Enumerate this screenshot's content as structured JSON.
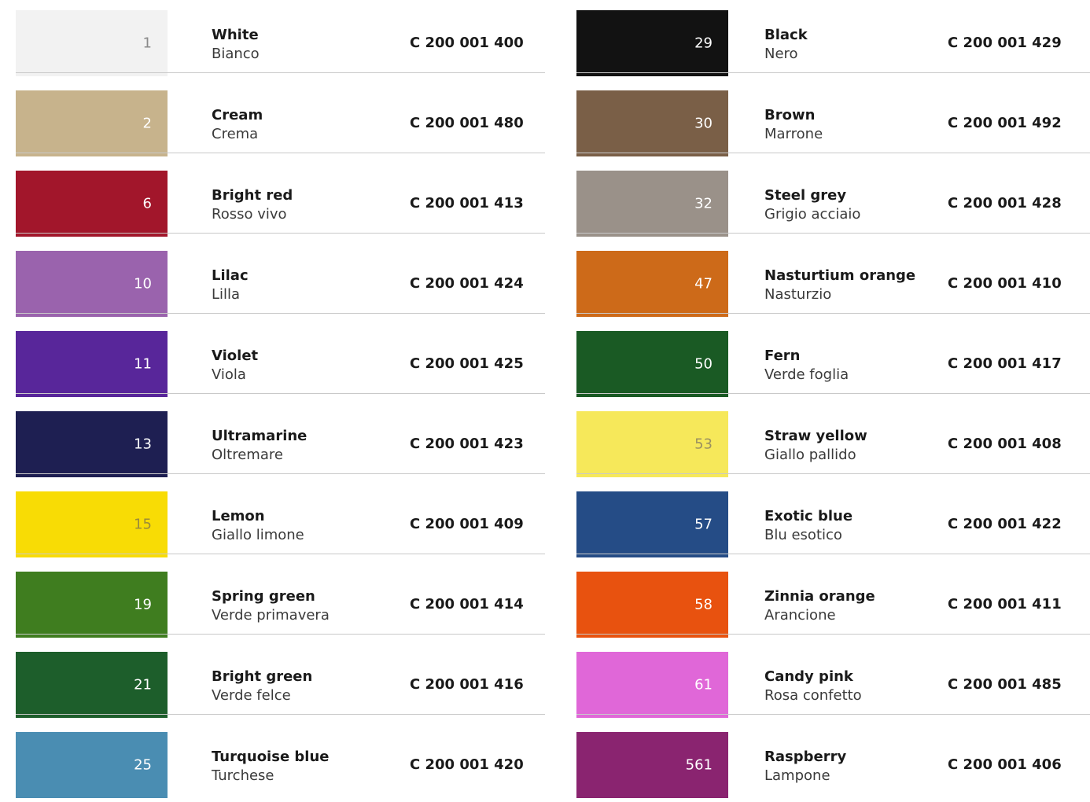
{
  "left_column": [
    {
      "number": "1",
      "name_en": "White",
      "name_it": "Bianco",
      "code": "C 200 001 400",
      "color": "#f2f2f2"
    },
    {
      "number": "2",
      "name_en": "Cream",
      "name_it": "Crema",
      "code": "C 200 001 480",
      "color": "#c7b38c"
    },
    {
      "number": "6",
      "name_en": "Bright red",
      "name_it": "Rosso vivo",
      "code": "C 200 001 413",
      "color": "#a2162b"
    },
    {
      "number": "10",
      "name_en": "Lilac",
      "name_it": "Lilla",
      "code": "C 200 001 424",
      "color": "#9a63ad"
    },
    {
      "number": "11",
      "name_en": "Violet",
      "name_it": "Viola",
      "code": "C 200 001 425",
      "color": "#58269a"
    },
    {
      "number": "13",
      "name_en": "Ultramarine",
      "name_it": "Oltremare",
      "code": "C 200 001 423",
      "color": "#1e1f52"
    },
    {
      "number": "15",
      "name_en": "Lemon",
      "name_it": "Giallo limone",
      "code": "C 200 001 409",
      "color": "#f8dc05"
    },
    {
      "number": "19",
      "name_en": "Spring green",
      "name_it": "Verde primavera",
      "code": "C 200 001 414",
      "color": "#3f7d1f"
    },
    {
      "number": "21",
      "name_en": "Bright green",
      "name_it": "Verde felce",
      "code": "C 200 001 416",
      "color": "#1d5e2b"
    },
    {
      "number": "25",
      "name_en": "Turquoise blue",
      "name_it": "Turchese",
      "code": "C 200 001 420",
      "color": "#4a8db2"
    }
  ],
  "right_column": [
    {
      "number": "29",
      "name_en": "Black",
      "name_it": "Nero",
      "code": "C 200 001 429",
      "color": "#121212"
    },
    {
      "number": "30",
      "name_en": "Brown",
      "name_it": "Marrone",
      "code": "C 200 001 492",
      "color": "#7a5f47"
    },
    {
      "number": "32",
      "name_en": "Steel grey",
      "name_it": "Grigio acciaio",
      "code": "C 200 001 428",
      "color": "#9a9189"
    },
    {
      "number": "47",
      "name_en": "Nasturtium orange",
      "name_it": "Nasturzio",
      "code": "C 200 001 410",
      "color": "#cd6a19"
    },
    {
      "number": "50",
      "name_en": "Fern",
      "name_it": "Verde foglia",
      "code": "C 200 001 417",
      "color": "#1a5a24"
    },
    {
      "number": "53",
      "name_en": "Straw yellow",
      "name_it": "Giallo pallido",
      "code": "C 200 001 408",
      "color": "#f6e85a"
    },
    {
      "number": "57",
      "name_en": "Exotic blue",
      "name_it": "Blu esotico",
      "code": "C 200 001 422",
      "color": "#254c86"
    },
    {
      "number": "58",
      "name_en": "Zinnia orange",
      "name_it": "Arancione",
      "code": "C 200 001 411",
      "color": "#e8520f"
    },
    {
      "number": "61",
      "name_en": "Candy pink",
      "name_it": "Rosa confetto",
      "code": "C 200 001 485",
      "color": "#e067d8"
    },
    {
      "number": "561",
      "name_en": "Raspberry",
      "name_it": "Lampone",
      "code": "C 200 001 406",
      "color": "#8a2470"
    }
  ]
}
